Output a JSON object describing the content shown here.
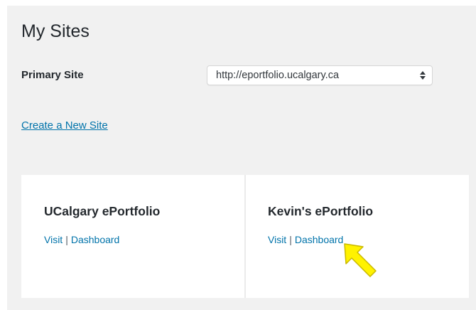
{
  "page": {
    "title": "My Sites"
  },
  "primary_site": {
    "label": "Primary Site",
    "selected": "http://eportfolio.ucalgary.ca",
    "arrows_icon": "select-arrows-icon"
  },
  "create_link": "Create a New Site",
  "sites": [
    {
      "name": "UCalgary ePortfolio",
      "visit_label": "Visit",
      "separator": "|",
      "dashboard_label": "Dashboard"
    },
    {
      "name": "Kevin's ePortfolio",
      "visit_label": "Visit",
      "separator": "|",
      "dashboard_label": "Dashboard"
    }
  ],
  "annotation": {
    "icon": "pointer-arrow-icon",
    "color": "#fff200"
  },
  "colors": {
    "link": "#0073aa",
    "panel_bg": "#f1f1f1",
    "card_bg": "#ffffff"
  }
}
